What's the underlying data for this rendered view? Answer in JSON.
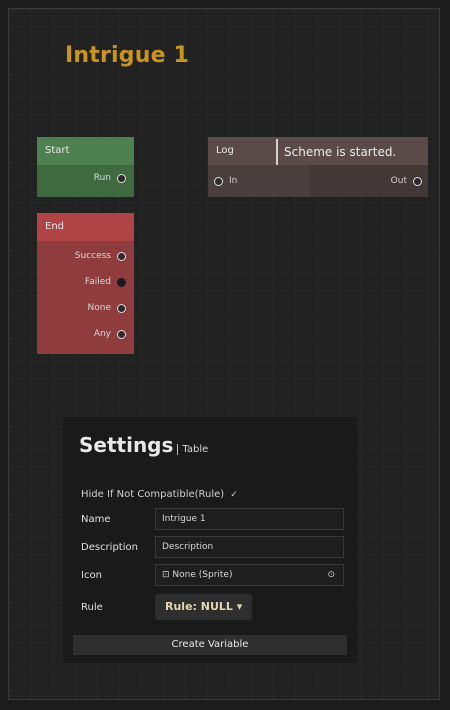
{
  "scheme_title": "Intrigue 1",
  "nodes": {
    "start": {
      "header": "Start",
      "ports": [
        "Run"
      ]
    },
    "end": {
      "header": "End",
      "ports": [
        "Success",
        "Failed",
        "None",
        "Any"
      ]
    },
    "log": {
      "header": "Log",
      "message": "Scheme is started.",
      "in_label": "In",
      "out_label": "Out"
    }
  },
  "settings": {
    "title": "Settings",
    "subtitle": "Table",
    "hide_label": "Hide If Not Compatible(Rule)",
    "hide_checked": "✓",
    "fields": {
      "name": {
        "label": "Name",
        "value": "Intrigue 1"
      },
      "description": {
        "label": "Description",
        "value": "Description"
      },
      "icon": {
        "label": "Icon",
        "value": "None (Sprite)",
        "prefix_icon": "⊡",
        "picker_icon": "⊙"
      },
      "rule": {
        "label": "Rule",
        "value": "Rule: NULL ▾"
      }
    },
    "create_button": "Create Variable"
  },
  "colors": {
    "accent_title": "#c8961e",
    "start_header": "#4f8150",
    "end_header": "#b04346",
    "log_header": "#5a4a4a"
  }
}
